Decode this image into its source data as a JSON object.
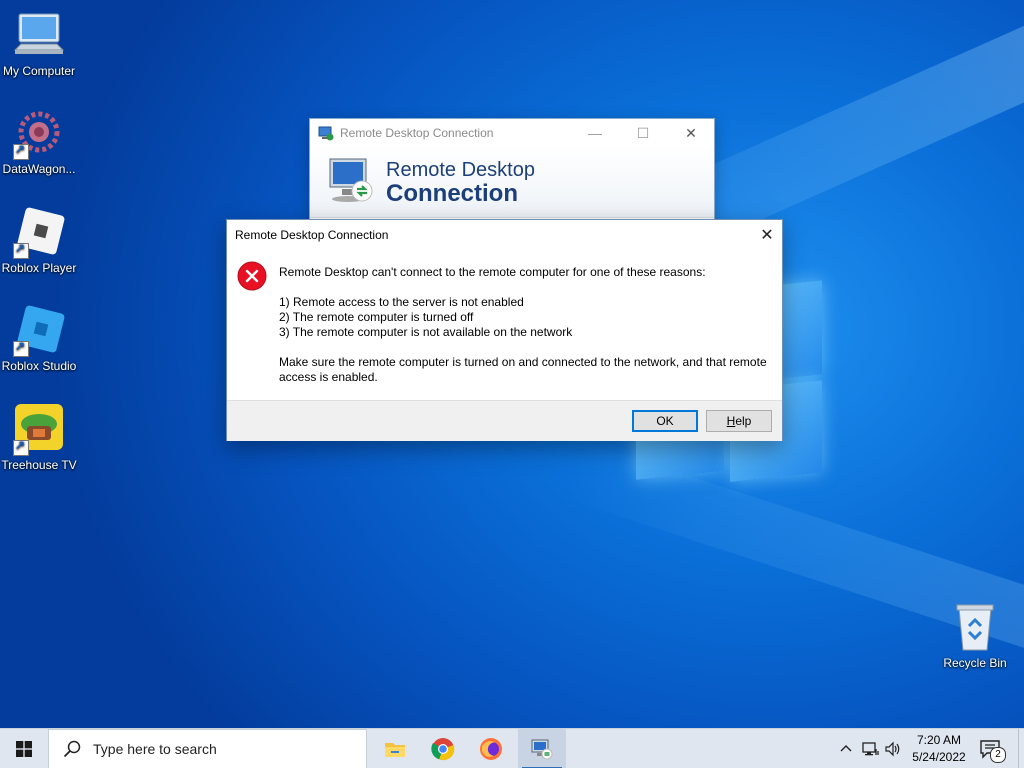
{
  "desktop": {
    "icons": [
      {
        "label": "My Computer",
        "icon": "my-computer-icon"
      },
      {
        "label": "DataWagon...",
        "icon": "datawagon-icon"
      },
      {
        "label": "Roblox Player",
        "icon": "roblox-player-icon"
      },
      {
        "label": "Roblox Studio",
        "icon": "roblox-studio-icon"
      },
      {
        "label": "Treehouse TV",
        "icon": "treehouse-tv-icon"
      },
      {
        "label": "Recycle Bin",
        "icon": "recycle-bin-icon"
      }
    ]
  },
  "rdc_window": {
    "title": "Remote Desktop Connection",
    "banner_line1": "Remote Desktop",
    "banner_line2": "Connection",
    "controls": {
      "minimize": "—",
      "maximize": "☐",
      "close": "✕"
    }
  },
  "error_dialog": {
    "title": "Remote Desktop Connection",
    "close": "✕",
    "message_intro": "Remote Desktop can't connect to the remote computer for one of these reasons:",
    "reasons": [
      "1) Remote access to the server is not enabled",
      "2) The remote computer is turned off",
      "3) The remote computer is not available on the network"
    ],
    "message_footer": "Make sure the remote computer is turned on and connected to the network, and that remote access is enabled.",
    "buttons": {
      "ok": "OK",
      "help_prefix": "H",
      "help_rest": "elp"
    }
  },
  "taskbar": {
    "search_placeholder": "Type here to search",
    "pinned": [
      "file-explorer-icon",
      "chrome-icon",
      "firefox-icon",
      "remote-desktop-icon"
    ],
    "clock_time": "7:20 AM",
    "clock_date": "5/24/2022",
    "notification_count": "2"
  },
  "colors": {
    "desktop_bg": "#0a6fd8",
    "dialog_accent": "#0078d7",
    "error_red": "#e81123",
    "taskbar_bg": "#dfe6ef"
  }
}
